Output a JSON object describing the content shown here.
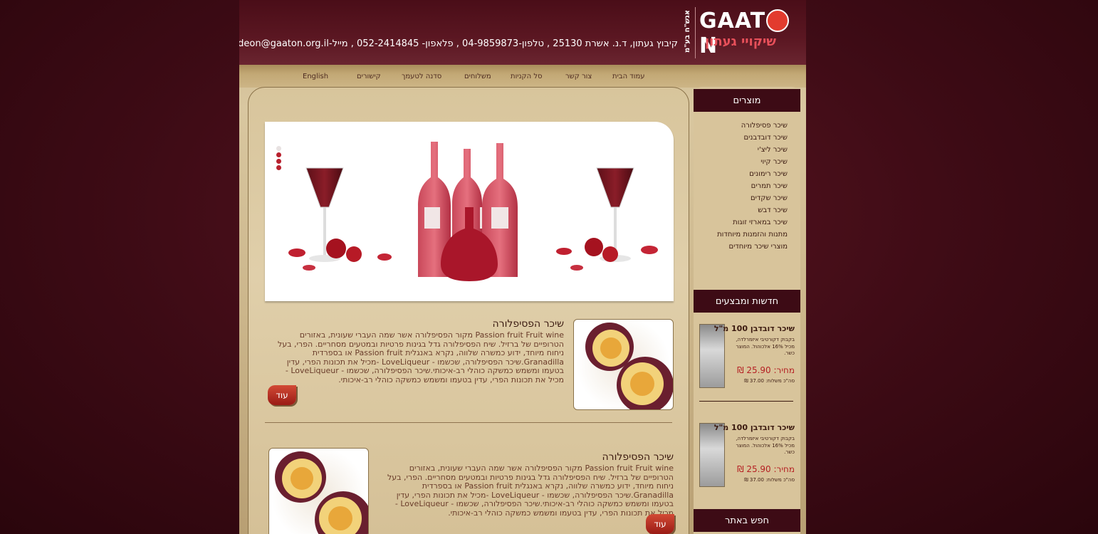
{
  "header": {
    "contact": "קיבוץ געתון, ד.נ. אשרת  25130 ,  טלפון-04-9859873 , פלאפון- 052-2414845   ,   מייל-gideon@gaaton.org.il",
    "logo_brand_pre": "GAAT",
    "logo_brand_post": "N",
    "logo_sub": "שיקויי געתון",
    "logo_tag": "אגש\"ח בע\"מ"
  },
  "nav": {
    "items": [
      "עמוד הבית",
      "צור קשר",
      "סל הקניות",
      "משלוחים",
      "סדנה לטעמך",
      "קישורים",
      "English"
    ]
  },
  "banner": {
    "slides": 4,
    "active_slide": 1
  },
  "articles": [
    {
      "title": "שיכר הפסיפלורה",
      "body": "Passion fruit Fruit wine מקור הפסיפלורה אשר שמה העברי שעונית, באזורים הטרופיים של ברזיל. שיח הפסיפלורה גדל בגינות פרטיות ובמטעים מסחריים. הפרי, בעל ניחוח מיוחד, ידוע כמשרה שלווה, נקרא באנגלית  Passion fruit  או בספרדית Granadilla.שיכר הפסיפלורה, שכשמו - LoveLiqueur -מכיל את תכונות הפרי, עדין בטעמו ומשמש   כמשקה כוהלי רב-איכותי.שיכר הפסיפלורה, שכשמו - LoveLiqueur - מכיל את תכונות הפרי, עדין בטעמו ומשמש כמשקה  כוהלי רב-איכותי.",
      "more": "עוד"
    },
    {
      "title": "שיכר הפסיפלורה",
      "body": "Passion fruit Fruit wine מקור הפסיפלורה אשר שמה העברי שעונית, באזורים הטרופיים של ברזיל. שיח הפסיפלורה גדל בגינות פרטיות ובמטעים מסחריים. הפרי, בעל ניחוח מיוחד, ידוע כמשרה שלווה, נקרא באנגלית  Passion fruit  או בספרדית Granadilla.שיכר הפסיפלורה, שכשמו - LoveLiqueur -מכיל את תכונות הפרי, עדין בטעמו ומשמש   כמשקה כוהלי רב-איכותי.שיכר הפסיפלורה, שכשמו - LoveLiqueur - מכיל את תכונות הפרי, עדין בטעמו ומשמש כמשקה  כוהלי רב-איכותי.",
      "more": "עוד"
    }
  ],
  "sidebar": {
    "products_title": "מוצרים",
    "products": [
      "שיכר פסיפלורה",
      "שיכר דובדבנים",
      "שיכר ליצ'י",
      "שיכר קיוי",
      "שיכר רימונים",
      "שיכר תמרים",
      "שיכר שקדים",
      "שיכר דבש",
      "שיכר במארזי זוגות",
      "מתנות והזמנות מיוחדות",
      "מוצרי שיכר מיוחדים"
    ],
    "news_title": "חדשות ומבצעים",
    "news": [
      {
        "title": "שיכר דובדבן 100 מ\"ל",
        "desc": "בקבוק דקורטיבי איזמרלדה, מכיל 16% אלכוהול. המוצר כשר.",
        "price": "מחיר: 25.90 ₪",
        "ship": "סה\"כ משלוח: 37.00 ₪"
      },
      {
        "title": "שיכר דובדבן 100 מ\"ל",
        "desc": "בקבוק דקורטיבי איזמרלדה, מכיל 16% אלכוהול. המוצר כשר.",
        "price": "מחיר: 25.90 ₪",
        "ship": "סה\"כ משלוח: 37.00 ₪"
      }
    ],
    "search_title": "חפש באתר"
  }
}
